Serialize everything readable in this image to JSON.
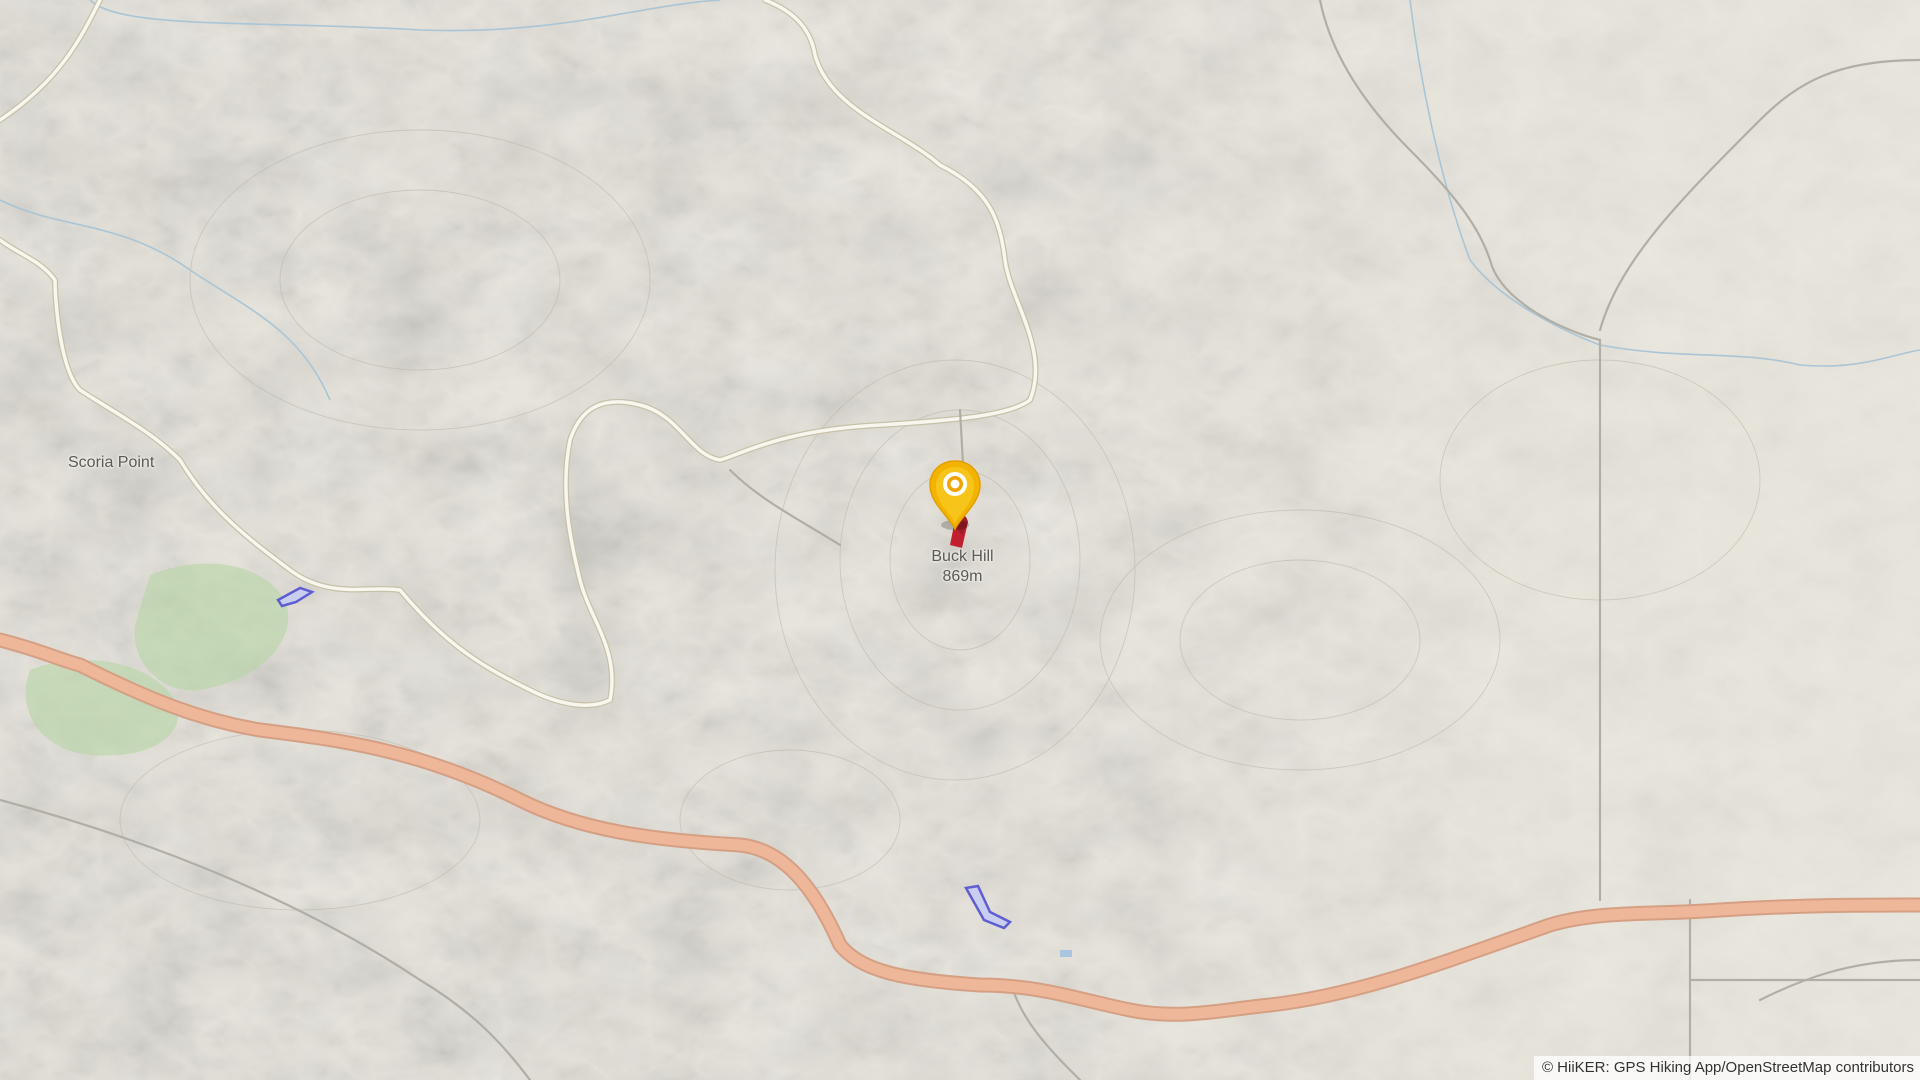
{
  "map": {
    "places": [
      {
        "name": "Scoria Point"
      }
    ],
    "peak": {
      "name": "Buck Hill",
      "elevation": "869m"
    },
    "marker": {
      "icon": "location-pin-icon",
      "color": "#f2b400"
    },
    "attribution": "© HiiKER: GPS Hiking App/OpenStreetMap contributors",
    "colors": {
      "terrain": "#e9e6dd",
      "highway": "#efb79a",
      "track": "#f8f6ee",
      "track_casing": "#c7c1a8",
      "river": "#a9c5d6",
      "water": "#6a6ad6",
      "forest": "#b6d6a4",
      "peak_marker": "#c01f2f"
    }
  }
}
